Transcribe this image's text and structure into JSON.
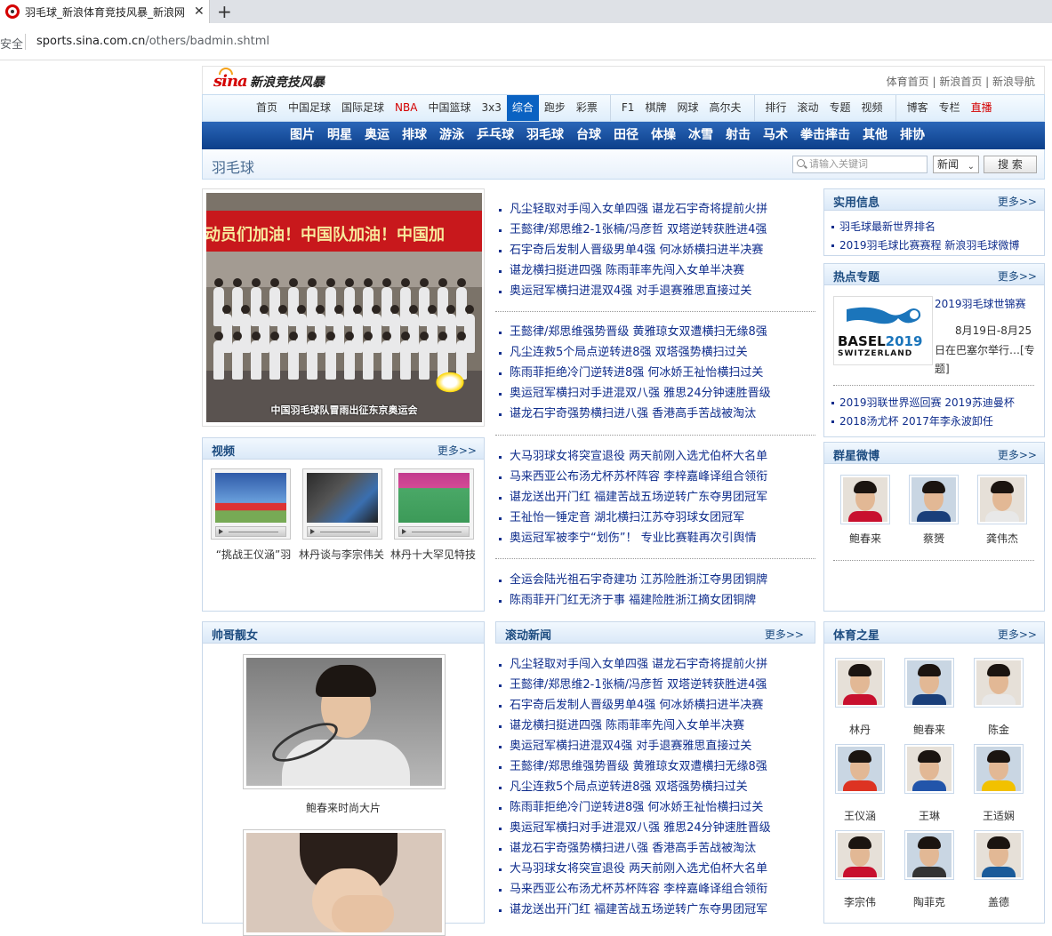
{
  "browser": {
    "tab_title": "羽毛球_新浪体育竞技风暴_新浪网",
    "security": "安全",
    "url_host": "sports.sina.com.cn",
    "url_path": "/others/badmin.shtml"
  },
  "header": {
    "logo_mark": "sina",
    "logo_text": "新浪竞技风暴",
    "links": "体育首页 | 新浪首页 | 新浪导航"
  },
  "nav1": [
    "首页",
    "中国足球",
    "国际足球",
    "NBA",
    "中国篮球",
    "3x3",
    "综合",
    "跑步",
    "彩票",
    "F1",
    "棋牌",
    "网球",
    "高尔夫",
    "排行",
    "滚动",
    "专题",
    "视频",
    "博客",
    "专栏",
    "直播"
  ],
  "nav2": [
    "图片",
    "明星",
    "奥运",
    "排球",
    "游泳",
    "乒乓球",
    "羽毛球",
    "台球",
    "田径",
    "体操",
    "冰雪",
    "射击",
    "马术",
    "拳击摔击",
    "其他",
    "排协"
  ],
  "channel": {
    "title": "羽毛球",
    "search_placeholder": "请输入关键词",
    "select": "新闻",
    "button": "搜 索"
  },
  "photo": {
    "banner": "动员们加油！中国队加油！中国加",
    "caption": "中国羽毛球队冒雨出征东京奥运会"
  },
  "video": {
    "title": "视频",
    "more": "更多>>",
    "items": [
      "“挑战王仪涵”羽",
      "林丹谈与李宗伟关",
      "林丹十大罕见特技"
    ]
  },
  "news_groups": [
    [
      "凡尘轻取对手闯入女单四强 谌龙石宇奇将提前火拼",
      "王懿律/郑思维2-1张楠/冯彦哲 双塔逆转获胜进4强",
      "石宇奇后发制人晋级男单4强 何冰娇横扫进半决赛",
      "谌龙横扫挺进四强 陈雨菲率先闯入女单半决赛",
      "奥运冠军横扫进混双4强 对手退赛雅思直接过关"
    ],
    [
      "王懿律/郑思维强势晋级 黄雅琼女双遭横扫无缘8强",
      "凡尘连救5个局点逆转进8强 双塔强势横扫过关",
      "陈雨菲拒绝冷门逆转进8强 何冰娇王祉怡横扫过关",
      "奥运冠军横扫对手进混双八强 雅思24分钟速胜晋级",
      "谌龙石宇奇强势横扫进八强 香港高手苦战被淘汰"
    ],
    [
      "大马羽球女将突宣退役 两天前刚入选尤伯杯大名单",
      "马来西亚公布汤尤杯苏杯阵容 李梓嘉峰译组合领衔",
      "谌龙送出开门红 福建苦战五场逆转广东夺男团冠军",
      "王祉怡一锤定音 湖北横扫江苏夺羽球女团冠军",
      "奥运冠军被李宁“划伤”！ 专业比赛鞋再次引舆情"
    ],
    [
      "全运会陆光祖石宇奇建功 江苏险胜浙江夺男团铜牌",
      "陈雨菲开门红无济于事 福建险胜浙江摘女团铜牌"
    ]
  ],
  "rolling": {
    "title": "滚动新闻",
    "more": "更多>>",
    "items": [
      "凡尘轻取对手闯入女单四强 谌龙石宇奇将提前火拼",
      "王懿律/郑思维2-1张楠/冯彦哲 双塔逆转获胜进4强",
      "石宇奇后发制人晋级男单4强 何冰娇横扫进半决赛",
      "谌龙横扫挺进四强 陈雨菲率先闯入女单半决赛",
      "奥运冠军横扫进混双4强 对手退赛雅思直接过关",
      "王懿律/郑思维强势晋级 黄雅琼女双遭横扫无缘8强",
      "凡尘连救5个局点逆转进8强 双塔强势横扫过关",
      "陈雨菲拒绝冷门逆转进8强 何冰娇王祉怡横扫过关",
      "奥运冠军横扫对手进混双八强 雅思24分钟速胜晋级",
      "谌龙石宇奇强势横扫进八强 香港高手苦战被淘汰",
      "大马羽球女将突宣退役 两天前刚入选尤伯杯大名单",
      "马来西亚公布汤尤杯苏杯阵容 李梓嘉峰译组合领衔",
      "谌龙送出开门红 福建苦战五场逆转广东夺男团冠军"
    ]
  },
  "info": {
    "title": "实用信息",
    "more": "更多>>",
    "items": [
      "羽毛球最新世界排名",
      "2019羽毛球比赛赛程 新浪羽毛球微博"
    ]
  },
  "topics": {
    "title": "热点专题",
    "more": "更多>>",
    "feature_title": "2019羽毛球世锦赛",
    "feature_date": "8月19日-8月25",
    "feature_desc1": "日在巴塞尔举行…[专",
    "feature_desc2": "题]",
    "logo_basel": "BASEL",
    "logo_year": "2019",
    "logo_country": "SWITZERLAND",
    "items": [
      "2019羽联世界巡回赛 2019苏迪曼杯",
      "2018汤尤杯 2017年李永波卸任"
    ]
  },
  "weibo": {
    "title": "群星微博",
    "more": "更多>>",
    "people": [
      "鲍春来",
      "蔡赟",
      "龚伟杰"
    ]
  },
  "handsome": {
    "title": "帅哥靓女",
    "caption": "鲍春来时尚大片"
  },
  "stars": {
    "title": "体育之星",
    "more": "更多>>",
    "people": [
      "林丹",
      "鲍春来",
      "陈金",
      "王仪涵",
      "王琳",
      "王适娴",
      "李宗伟",
      "陶菲克",
      "盖德"
    ]
  },
  "colors": {
    "nav_dark": "#0c3f8a",
    "link": "#0f2d8c",
    "accent_red": "#d40000"
  }
}
